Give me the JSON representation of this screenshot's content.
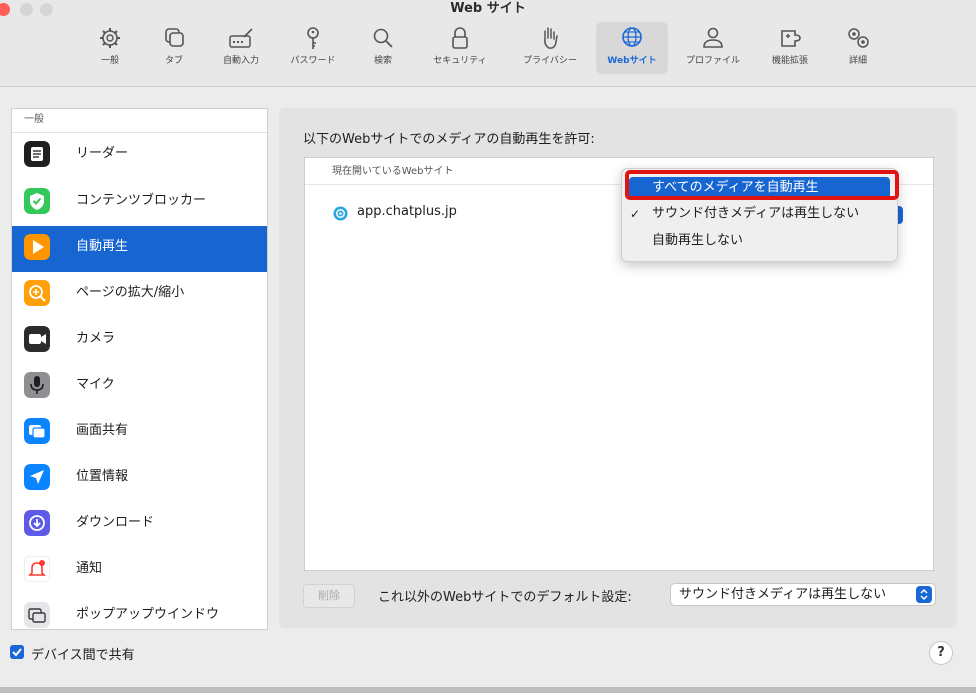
{
  "window": {
    "title": "Web サイト"
  },
  "toolbar": {
    "items": [
      {
        "label": "一般",
        "icon": "gear-icon"
      },
      {
        "label": "タブ",
        "icon": "tabs-icon"
      },
      {
        "label": "自動入力",
        "icon": "keyboard-pencil-icon"
      },
      {
        "label": "パスワード",
        "icon": "key-icon"
      },
      {
        "label": "検索",
        "icon": "magnifier-icon"
      },
      {
        "label": "セキュリティ",
        "icon": "lock-icon"
      },
      {
        "label": "プライバシー",
        "icon": "hand-icon"
      },
      {
        "label": "Webサイト",
        "icon": "globe-icon",
        "selected": true
      },
      {
        "label": "プロファイル",
        "icon": "person-icon"
      },
      {
        "label": "機能拡張",
        "icon": "puzzle-icon"
      },
      {
        "label": "詳細",
        "icon": "gears-icon"
      }
    ]
  },
  "sidebar": {
    "section_title": "一般",
    "items": [
      {
        "label": "リーダー",
        "icon": "reader-icon",
        "color": "#1f1f1f"
      },
      {
        "label": "コンテンツブロッカー",
        "icon": "shield-check-icon",
        "color": "#34c759"
      },
      {
        "label": "自動再生",
        "icon": "play-icon",
        "color": "#ff9500",
        "selected": true
      },
      {
        "label": "ページの拡大/縮小",
        "icon": "zoom-icon",
        "color": "#ff9f0a"
      },
      {
        "label": "カメラ",
        "icon": "camera-icon",
        "color": "#2c2c2e"
      },
      {
        "label": "マイク",
        "icon": "microphone-icon",
        "color": "#8e8e93"
      },
      {
        "label": "画面共有",
        "icon": "screen-share-icon",
        "color": "#0a84ff"
      },
      {
        "label": "位置情報",
        "icon": "location-arrow-icon",
        "color": "#0a84ff"
      },
      {
        "label": "ダウンロード",
        "icon": "download-icon",
        "color": "#5e5ce6"
      },
      {
        "label": "通知",
        "icon": "bell-icon",
        "color": "#ffffff"
      },
      {
        "label": "ポップアップウインドウ",
        "icon": "popup-window-icon",
        "color": "#e5e5ea"
      }
    ]
  },
  "main": {
    "caption": "以下のWebサイトでのメディアの自動再生を許可:",
    "list_header": "現在開いているWebサイト",
    "sites": [
      {
        "name": "app.chatplus.jp"
      }
    ],
    "dropdown": {
      "options": [
        {
          "label": "すべてのメディアを自動再生",
          "highlighted": true
        },
        {
          "label": "サウンド付きメディアは再生しない",
          "checked": true,
          "check_mark": "✓"
        },
        {
          "label": "自動再生しない"
        }
      ]
    },
    "delete_label": "削除",
    "default_label": "これ以外のWebサイトでのデフォルト設定:",
    "default_value": "サウンド付きメディアは再生しない"
  },
  "footer": {
    "share_label": "デバイス間で共有",
    "share_checked": true,
    "help_label": "?"
  },
  "colors": {
    "accent": "#1765d0",
    "annotation": "#e01313"
  }
}
